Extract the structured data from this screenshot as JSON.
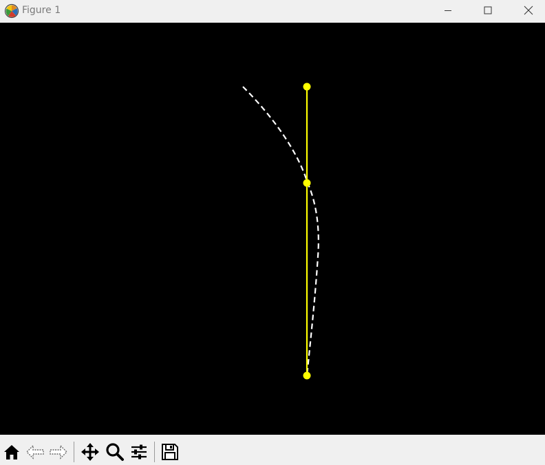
{
  "window": {
    "title": "Figure 1",
    "icons": {
      "app": "matplotlib-icon",
      "minimize": "minimize-icon",
      "maximize": "maximize-icon",
      "close": "close-icon"
    }
  },
  "figure": {
    "background": "#000000",
    "pendulum_color": "#ffff00",
    "trace_color": "#ffffff",
    "trace_style": "dashed"
  },
  "toolbar": {
    "buttons": [
      {
        "name": "home",
        "icon": "home-icon"
      },
      {
        "name": "back",
        "icon": "back-arrow-icon"
      },
      {
        "name": "forward",
        "icon": "forward-arrow-icon"
      },
      {
        "name": "pan",
        "icon": "move-icon"
      },
      {
        "name": "zoom",
        "icon": "zoom-icon"
      },
      {
        "name": "configure-subplots",
        "icon": "sliders-icon"
      },
      {
        "name": "save",
        "icon": "save-icon"
      }
    ]
  }
}
